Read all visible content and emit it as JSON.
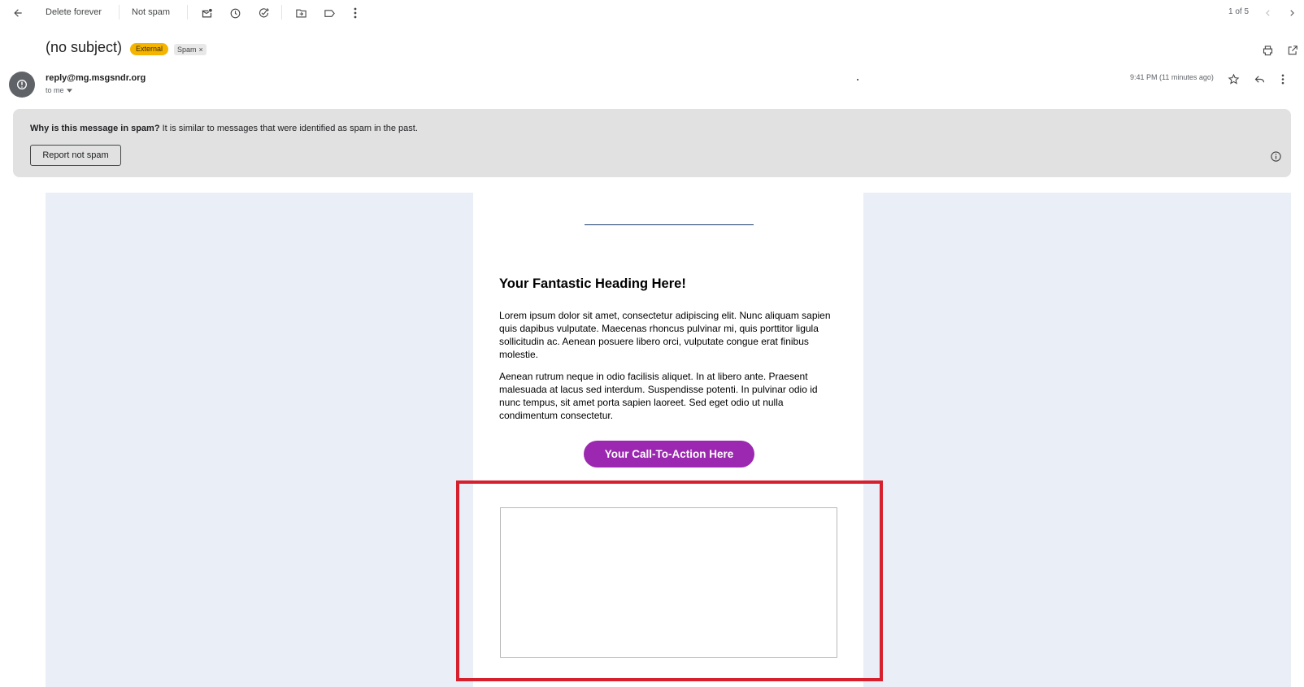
{
  "toolbar": {
    "back_icon": "arrow-back-icon",
    "delete_forever_label": "Delete forever",
    "not_spam_label": "Not spam",
    "icons": [
      "mark-unread-icon",
      "snooze-icon",
      "add-task-icon",
      "move-to-icon",
      "label-icon",
      "more-vert-icon"
    ],
    "pager_text": "1 of 5"
  },
  "message": {
    "subject": "(no subject)",
    "badge_external": "External",
    "badge_spam": "Spam",
    "sender_email": "reply@mg.msgsndr.org",
    "recipient": "to me",
    "timestamp": "9:41 PM (11 minutes ago)"
  },
  "spam_banner": {
    "question": "Why is this message in spam?",
    "explanation": "It is similar to messages that were identified as spam in the past.",
    "report_button": "Report not spam"
  },
  "email_body": {
    "heading": "Your Fantastic Heading Here!",
    "paragraph1": "Lorem ipsum dolor sit amet, consectetur adipiscing elit. Nunc aliquam sapien quis dapibus vulputate. Maecenas rhoncus pulvinar mi, quis porttitor ligula sollicitudin ac. Aenean posuere libero orci, vulputate congue erat finibus molestie.",
    "paragraph2": "Aenean rutrum neque in odio facilisis aliquet. In at libero ante. Praesent malesuada at lacus sed interdum. Suspendisse potenti. In pulvinar odio id nunc tempus, sit amet porta sapien laoreet. Sed eget odio ut nulla condimentum consectetur.",
    "cta_label": "Your Call-To-Action Here"
  },
  "colors": {
    "external_badge": "#f4b400",
    "cta": "#9c27b0",
    "email_background": "#eaeef6",
    "highlight_border": "#d7202e"
  }
}
